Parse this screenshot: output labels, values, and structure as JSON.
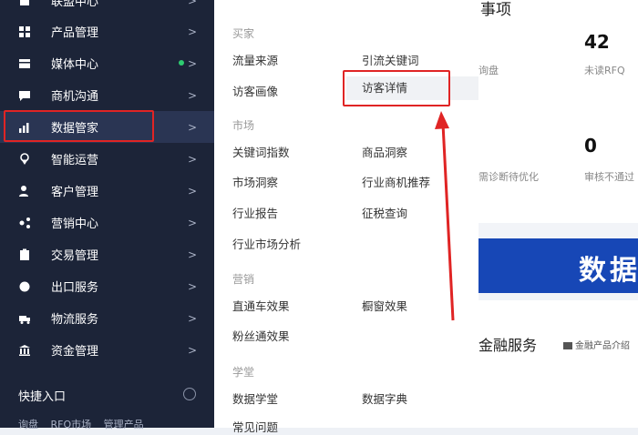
{
  "sidebar": {
    "items": [
      {
        "label": "联盟中心",
        "icon": "home-icon"
      },
      {
        "label": "产品管理",
        "icon": "grid-icon"
      },
      {
        "label": "媒体中心",
        "icon": "media-icon"
      },
      {
        "label": "商机沟通",
        "icon": "chat-icon"
      },
      {
        "label": "数据管家",
        "icon": "bar-chart-icon"
      },
      {
        "label": "智能运营",
        "icon": "location-icon"
      },
      {
        "label": "客户管理",
        "icon": "user-icon"
      },
      {
        "label": "营销中心",
        "icon": "marketing-icon"
      },
      {
        "label": "交易管理",
        "icon": "clipboard-icon"
      },
      {
        "label": "出口服务",
        "icon": "globe-icon"
      },
      {
        "label": "物流服务",
        "icon": "truck-icon"
      },
      {
        "label": "资金管理",
        "icon": "bank-icon"
      }
    ],
    "arrow": ">",
    "quick_entry": "快捷入口",
    "bottom_links": [
      "询盘",
      "RFQ市场",
      "管理产品"
    ]
  },
  "menu": {
    "sections": [
      {
        "title": "买家",
        "items": [
          "流量来源",
          "引流关键词",
          "访客画像",
          "访客详情"
        ]
      },
      {
        "title": "市场",
        "items": [
          "关键词指数",
          "商品洞察",
          "市场洞察",
          "行业商机推荐",
          "行业报告",
          "征税查询",
          "行业市场分析"
        ]
      },
      {
        "title": "营销",
        "items": [
          "直通车效果",
          "橱窗效果",
          "粉丝通效果"
        ]
      },
      {
        "title": "学堂",
        "items": [
          "数据学堂",
          "数据字典",
          "常见问题"
        ]
      }
    ]
  },
  "content": {
    "card_title": "事项",
    "num_left_label": "询盘",
    "num_right": "42",
    "num_right_label": "未读RFQ",
    "num_bottom": "0",
    "num_bottom_label_left": "需诊断待优化",
    "num_bottom_label_right": "审核不通过",
    "banner_text": "数据",
    "finance_title": "金融服务",
    "finance_link": "金融产品介绍"
  },
  "colors": {
    "sidebar_bg": "#1c2438",
    "highlight": "#e02424",
    "banner": "#1747b6"
  }
}
